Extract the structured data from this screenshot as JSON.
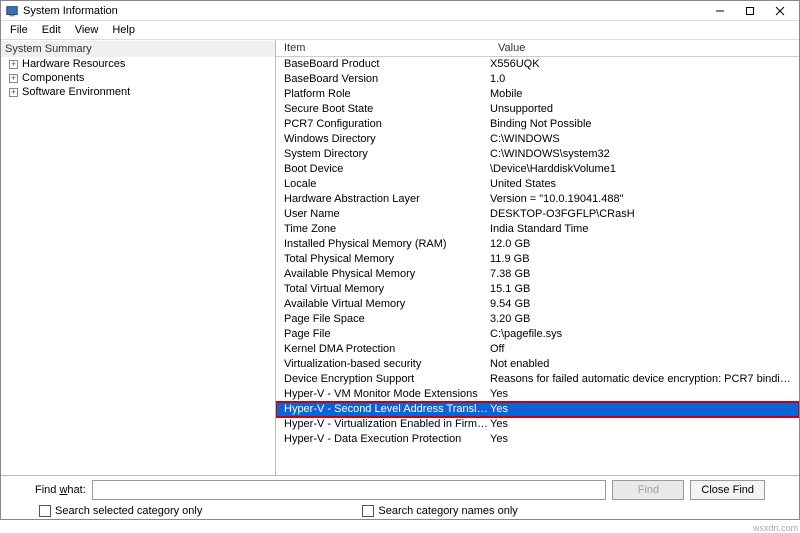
{
  "window": {
    "title": "System Information"
  },
  "menu": {
    "file": "File",
    "edit": "Edit",
    "view": "View",
    "help": "Help"
  },
  "tree": {
    "header": "System Summary",
    "items": [
      {
        "label": "Hardware Resources"
      },
      {
        "label": "Components"
      },
      {
        "label": "Software Environment"
      }
    ]
  },
  "list": {
    "col_item": "Item",
    "col_value": "Value",
    "rows": [
      {
        "item": "BaseBoard Product",
        "value": "X556UQK"
      },
      {
        "item": "BaseBoard Version",
        "value": "1.0"
      },
      {
        "item": "Platform Role",
        "value": "Mobile"
      },
      {
        "item": "Secure Boot State",
        "value": "Unsupported"
      },
      {
        "item": "PCR7 Configuration",
        "value": "Binding Not Possible"
      },
      {
        "item": "Windows Directory",
        "value": "C:\\WINDOWS"
      },
      {
        "item": "System Directory",
        "value": "C:\\WINDOWS\\system32"
      },
      {
        "item": "Boot Device",
        "value": "\\Device\\HarddiskVolume1"
      },
      {
        "item": "Locale",
        "value": "United States"
      },
      {
        "item": "Hardware Abstraction Layer",
        "value": "Version = \"10.0.19041.488\""
      },
      {
        "item": "User Name",
        "value": "DESKTOP-O3FGFLP\\CRasH"
      },
      {
        "item": "Time Zone",
        "value": "India Standard Time"
      },
      {
        "item": "Installed Physical Memory (RAM)",
        "value": "12.0 GB"
      },
      {
        "item": "Total Physical Memory",
        "value": "11.9 GB"
      },
      {
        "item": "Available Physical Memory",
        "value": "7.38 GB"
      },
      {
        "item": "Total Virtual Memory",
        "value": "15.1 GB"
      },
      {
        "item": "Available Virtual Memory",
        "value": "9.54 GB"
      },
      {
        "item": "Page File Space",
        "value": "3.20 GB"
      },
      {
        "item": "Page File",
        "value": "C:\\pagefile.sys"
      },
      {
        "item": "Kernel DMA Protection",
        "value": "Off"
      },
      {
        "item": "Virtualization-based security",
        "value": "Not enabled"
      },
      {
        "item": "Device Encryption Support",
        "value": "Reasons for failed automatic device encryption: PCR7 bindi…"
      },
      {
        "item": "Hyper-V - VM Monitor Mode Extensions",
        "value": "Yes"
      },
      {
        "item": "Hyper-V - Second Level Address Translation …",
        "value": "Yes",
        "selected": true
      },
      {
        "item": "Hyper-V - Virtualization Enabled in Firmware",
        "value": "Yes"
      },
      {
        "item": "Hyper-V - Data Execution Protection",
        "value": "Yes"
      }
    ]
  },
  "findbar": {
    "label_prefix": "Find ",
    "label_accel": "w",
    "label_suffix": "hat:",
    "find_btn": "Find",
    "close_btn": "Close Find",
    "chk1": "Search selected category only",
    "chk2": "Search category names only",
    "input_value": ""
  },
  "attribution": "wsxdn.com"
}
